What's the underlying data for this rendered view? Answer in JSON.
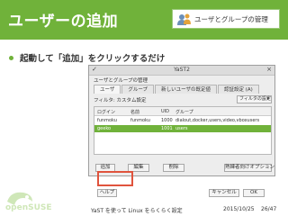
{
  "slide": {
    "title": "ユーザーの追加",
    "badge_label": "ユーザとグループの管理",
    "badge_icon": "users-group-icon",
    "bullet": "起動して「追加」をクリックするだけ"
  },
  "window": {
    "title": "YaST2",
    "module_title": "ユーザとグループの管理",
    "tabs": [
      {
        "label": "ユーザ",
        "active": true
      },
      {
        "label": "グループ",
        "active": false
      },
      {
        "label": "新しいユーザの既定値",
        "active": false
      },
      {
        "label": "認証設定 (A)",
        "active": false
      }
    ],
    "filter_label": "フィルタ: カスタム設定",
    "filter_button": "フィルタの設定",
    "table": {
      "columns": [
        "ログイン",
        "名前",
        "UID",
        "グループ"
      ],
      "rows": [
        {
          "login": "funmoku",
          "name": "funmoku",
          "uid": "1000",
          "groups": "dialout,docker,users,video,vboxusers",
          "selected": false
        },
        {
          "login": "geeko",
          "name": "",
          "uid": "1001",
          "groups": "users",
          "selected": true
        }
      ]
    },
    "buttons": {
      "add": "追加",
      "edit": "編集",
      "delete": "削除",
      "expert": "熟練者向けオプション",
      "help": "ヘルプ",
      "cancel": "キャンセル",
      "ok": "OK"
    }
  },
  "footer": {
    "logo_text": "openSUSE",
    "title": "YaST を使って Linux をらくらく設定",
    "date": "2015/10/25",
    "page": "26/47"
  },
  "colors": {
    "accent": "#70b23a",
    "highlight": "#e0533d"
  }
}
